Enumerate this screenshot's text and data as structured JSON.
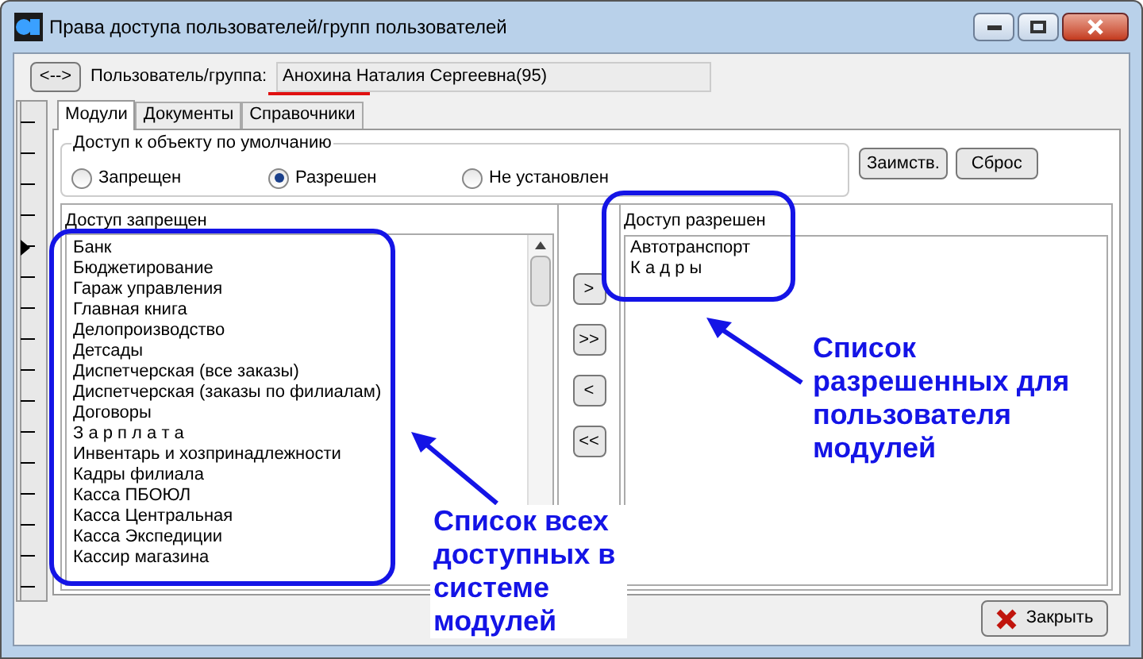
{
  "window": {
    "title": "Права доступа пользователей/групп пользователей"
  },
  "user_selector": {
    "swap_button": "<-->",
    "label": "Пользователь/группа:",
    "value": "Анохина Наталия Сергеевна(95)"
  },
  "tabs": [
    {
      "label": "Модули",
      "selected": true
    },
    {
      "label": "Документы",
      "selected": false
    },
    {
      "label": "Справочники",
      "selected": false
    }
  ],
  "default_access": {
    "title": "Доступ к объекту по умолчанию",
    "options": [
      {
        "label": "Запрещен",
        "selected": false
      },
      {
        "label": "Разрешен",
        "selected": true
      },
      {
        "label": "Не установлен",
        "selected": false
      }
    ]
  },
  "side_buttons": [
    "Заимств.",
    "Сброс"
  ],
  "denied_panel": {
    "header": "Доступ запрещен",
    "items": [
      "Банк",
      "Бюджетирование",
      "Гараж управления",
      "Главная книга",
      "Делопроизводство",
      "Детсады",
      "Диспетчерская (все заказы)",
      "Диспетчерская (заказы по филиалам)",
      "Договоры",
      "З а р п л а т а",
      "Инвентарь и хозпринадлежности",
      "Кадры филиала",
      "Касса ПБОЮЛ",
      "Касса Центральная",
      "Касса Экспедиции",
      "Кассир магазина"
    ]
  },
  "transfer_buttons": [
    ">",
    ">>",
    "<",
    "<<"
  ],
  "allowed_panel": {
    "header": "Доступ разрешен",
    "items": [
      "Автотранспорт",
      "К а д р ы"
    ]
  },
  "close_button": "Закрыть",
  "annotations": [
    {
      "text": "Список всех доступных в системе модулей"
    },
    {
      "text": "Список разрешенных для пользователя модулей"
    }
  ]
}
